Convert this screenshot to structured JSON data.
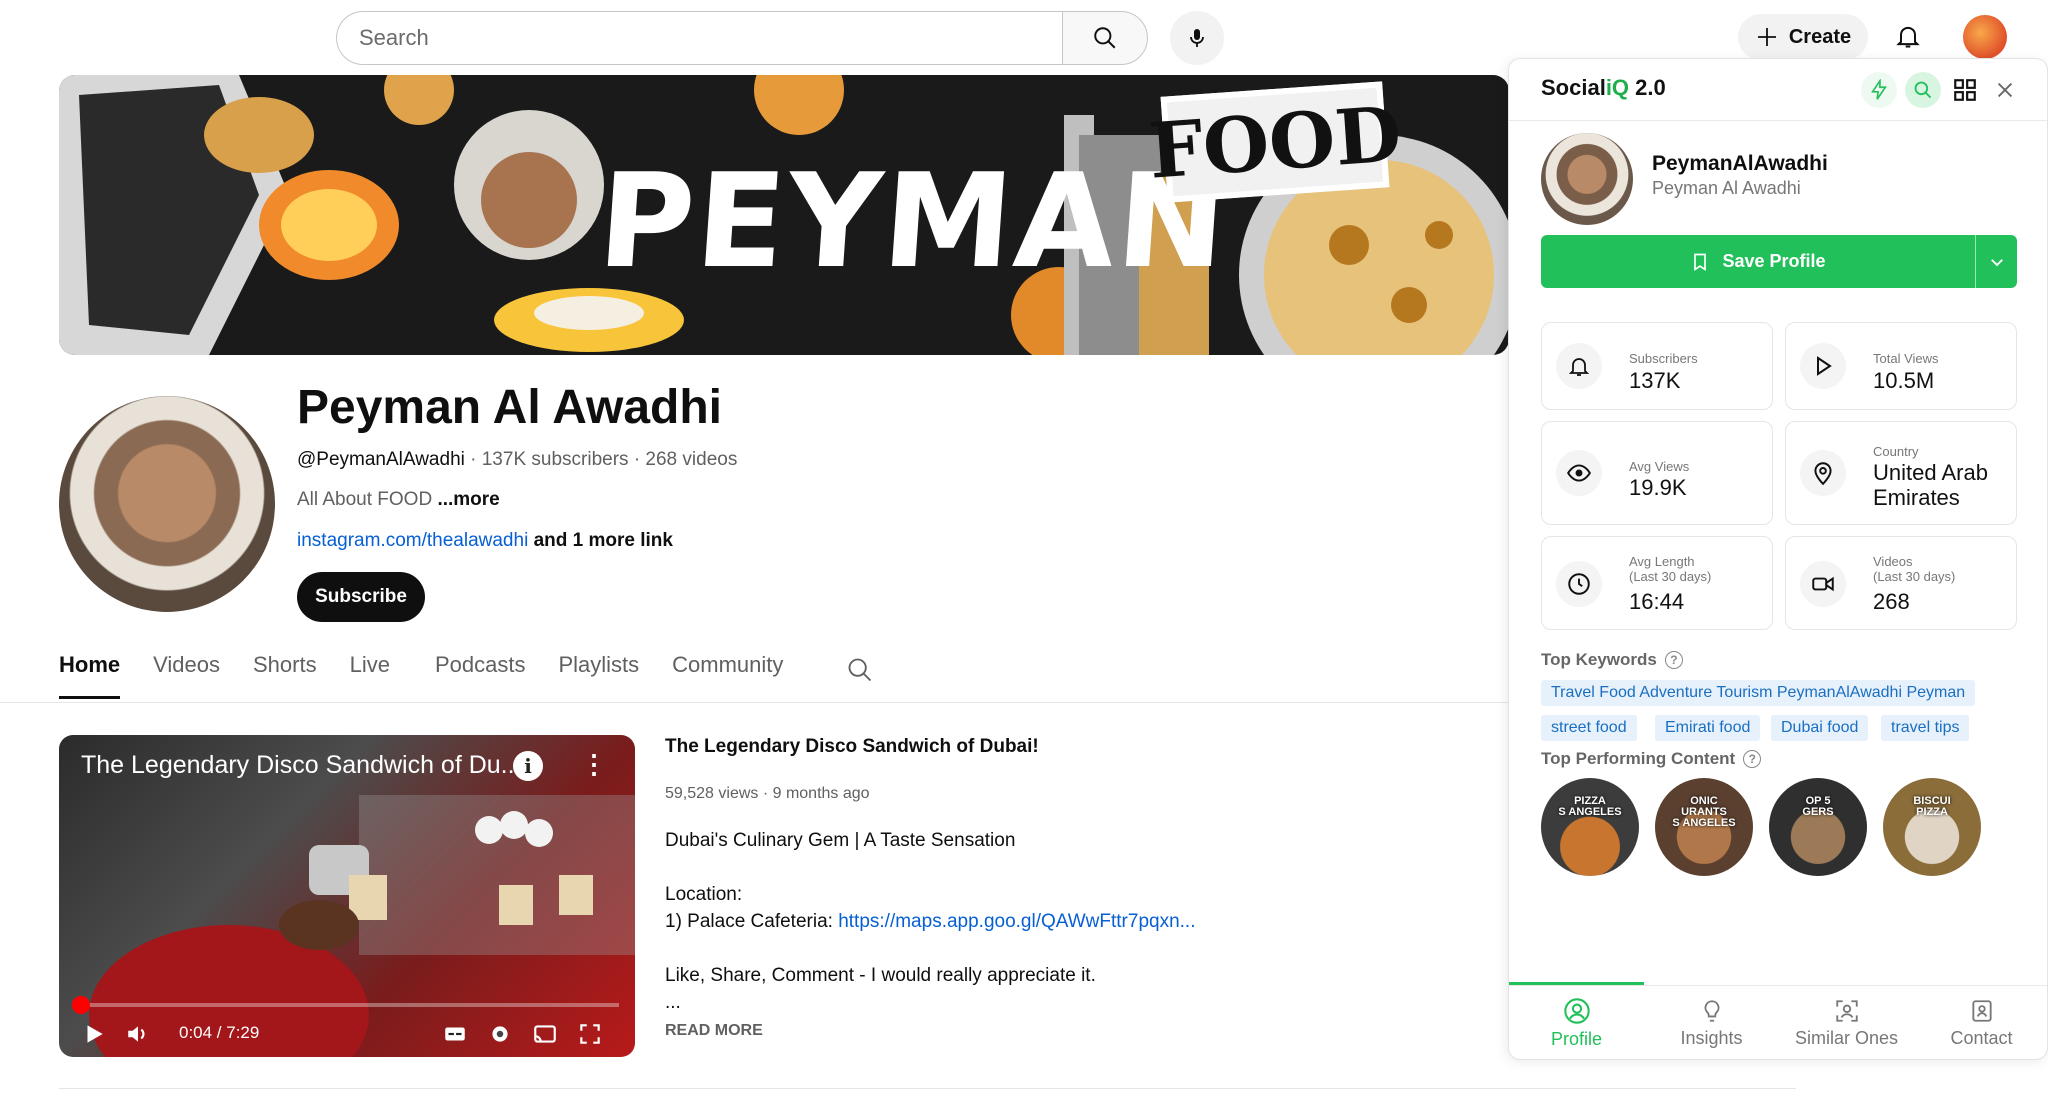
{
  "topbar": {
    "search_placeholder": "Search",
    "create_label": "Create"
  },
  "banner": {
    "title": "PEYMAN",
    "food_sign": "FOOD"
  },
  "channel": {
    "name": "Peyman Al Awadhi",
    "handle": "@PeymanAlAwadhi",
    "stats": " · 137K subscribers · 268 videos",
    "description": "All About FOOD",
    "more": " ...more",
    "link": "instagram.com/thealawadhi",
    "link_more": " and 1 more link",
    "subscribe_label": "Subscribe"
  },
  "tabs": [
    {
      "label": "Home",
      "active": true
    },
    {
      "label": "Videos"
    },
    {
      "label": "Shorts"
    },
    {
      "label": "Live"
    },
    {
      "label": "Podcasts"
    },
    {
      "label": "Playlists"
    },
    {
      "label": "Community"
    }
  ],
  "video": {
    "overlay_title": "The Legendary Disco Sandwich of Du...",
    "time": "0:04 / 7:29",
    "progress_fraction": 0.009,
    "title": "The Legendary Disco Sandwich of Dubai!",
    "meta": "59,528 views · 9 months ago",
    "line1": "Dubai's Culinary Gem | A Taste Sensation",
    "line2": "Location:",
    "line3_prefix": "1) Palace Cafeteria: ",
    "line3_link": "https://maps.app.goo.gl/QAWwFttr7pqxn...",
    "line4": "Like, Share, Comment - I would really appreciate it.",
    "line5": "...",
    "read_more": "READ MORE"
  },
  "panel": {
    "logo_prefix": "Social",
    "logo_accent": "iQ",
    "logo_suffix": " 2.0",
    "username": "PeymanAlAwadhi",
    "full_name": "Peyman Al Awadhi",
    "save_label": "Save Profile",
    "stats": {
      "subscribers_label": "Subscribers",
      "subscribers_value": "137K",
      "total_views_label": "Total Views",
      "total_views_value": "10.5M",
      "avg_views_label": "Avg Views",
      "avg_views_value": "19.9K",
      "country_label": "Country",
      "country_value_1": "United Arab",
      "country_value_2": "Emirates",
      "avg_length_label": "Avg Length",
      "avg_length_sub": "(Last 30 days)",
      "avg_length_value": "16:44",
      "videos_label": "Videos",
      "videos_sub": "(Last 30 days)",
      "videos_value": "268"
    },
    "top_keywords_label": "Top Keywords",
    "keywords": [
      "Travel Food Adventure Tourism PeymanAlAwadhi Peyman",
      "street food",
      "Emirati food",
      "Dubai food",
      "travel tips"
    ],
    "top_content_label": "Top Performing Content",
    "thumbs": [
      "PIZZA\nS ANGELES",
      "ONIC\nURANTS\nS ANGELES",
      "OP 5\nGERS",
      "BISCUI\nPIZZA"
    ],
    "bottom_tabs": [
      "Profile",
      "Insights",
      "Similar Ones",
      "Contact"
    ],
    "accent_color": "#22c05a"
  }
}
